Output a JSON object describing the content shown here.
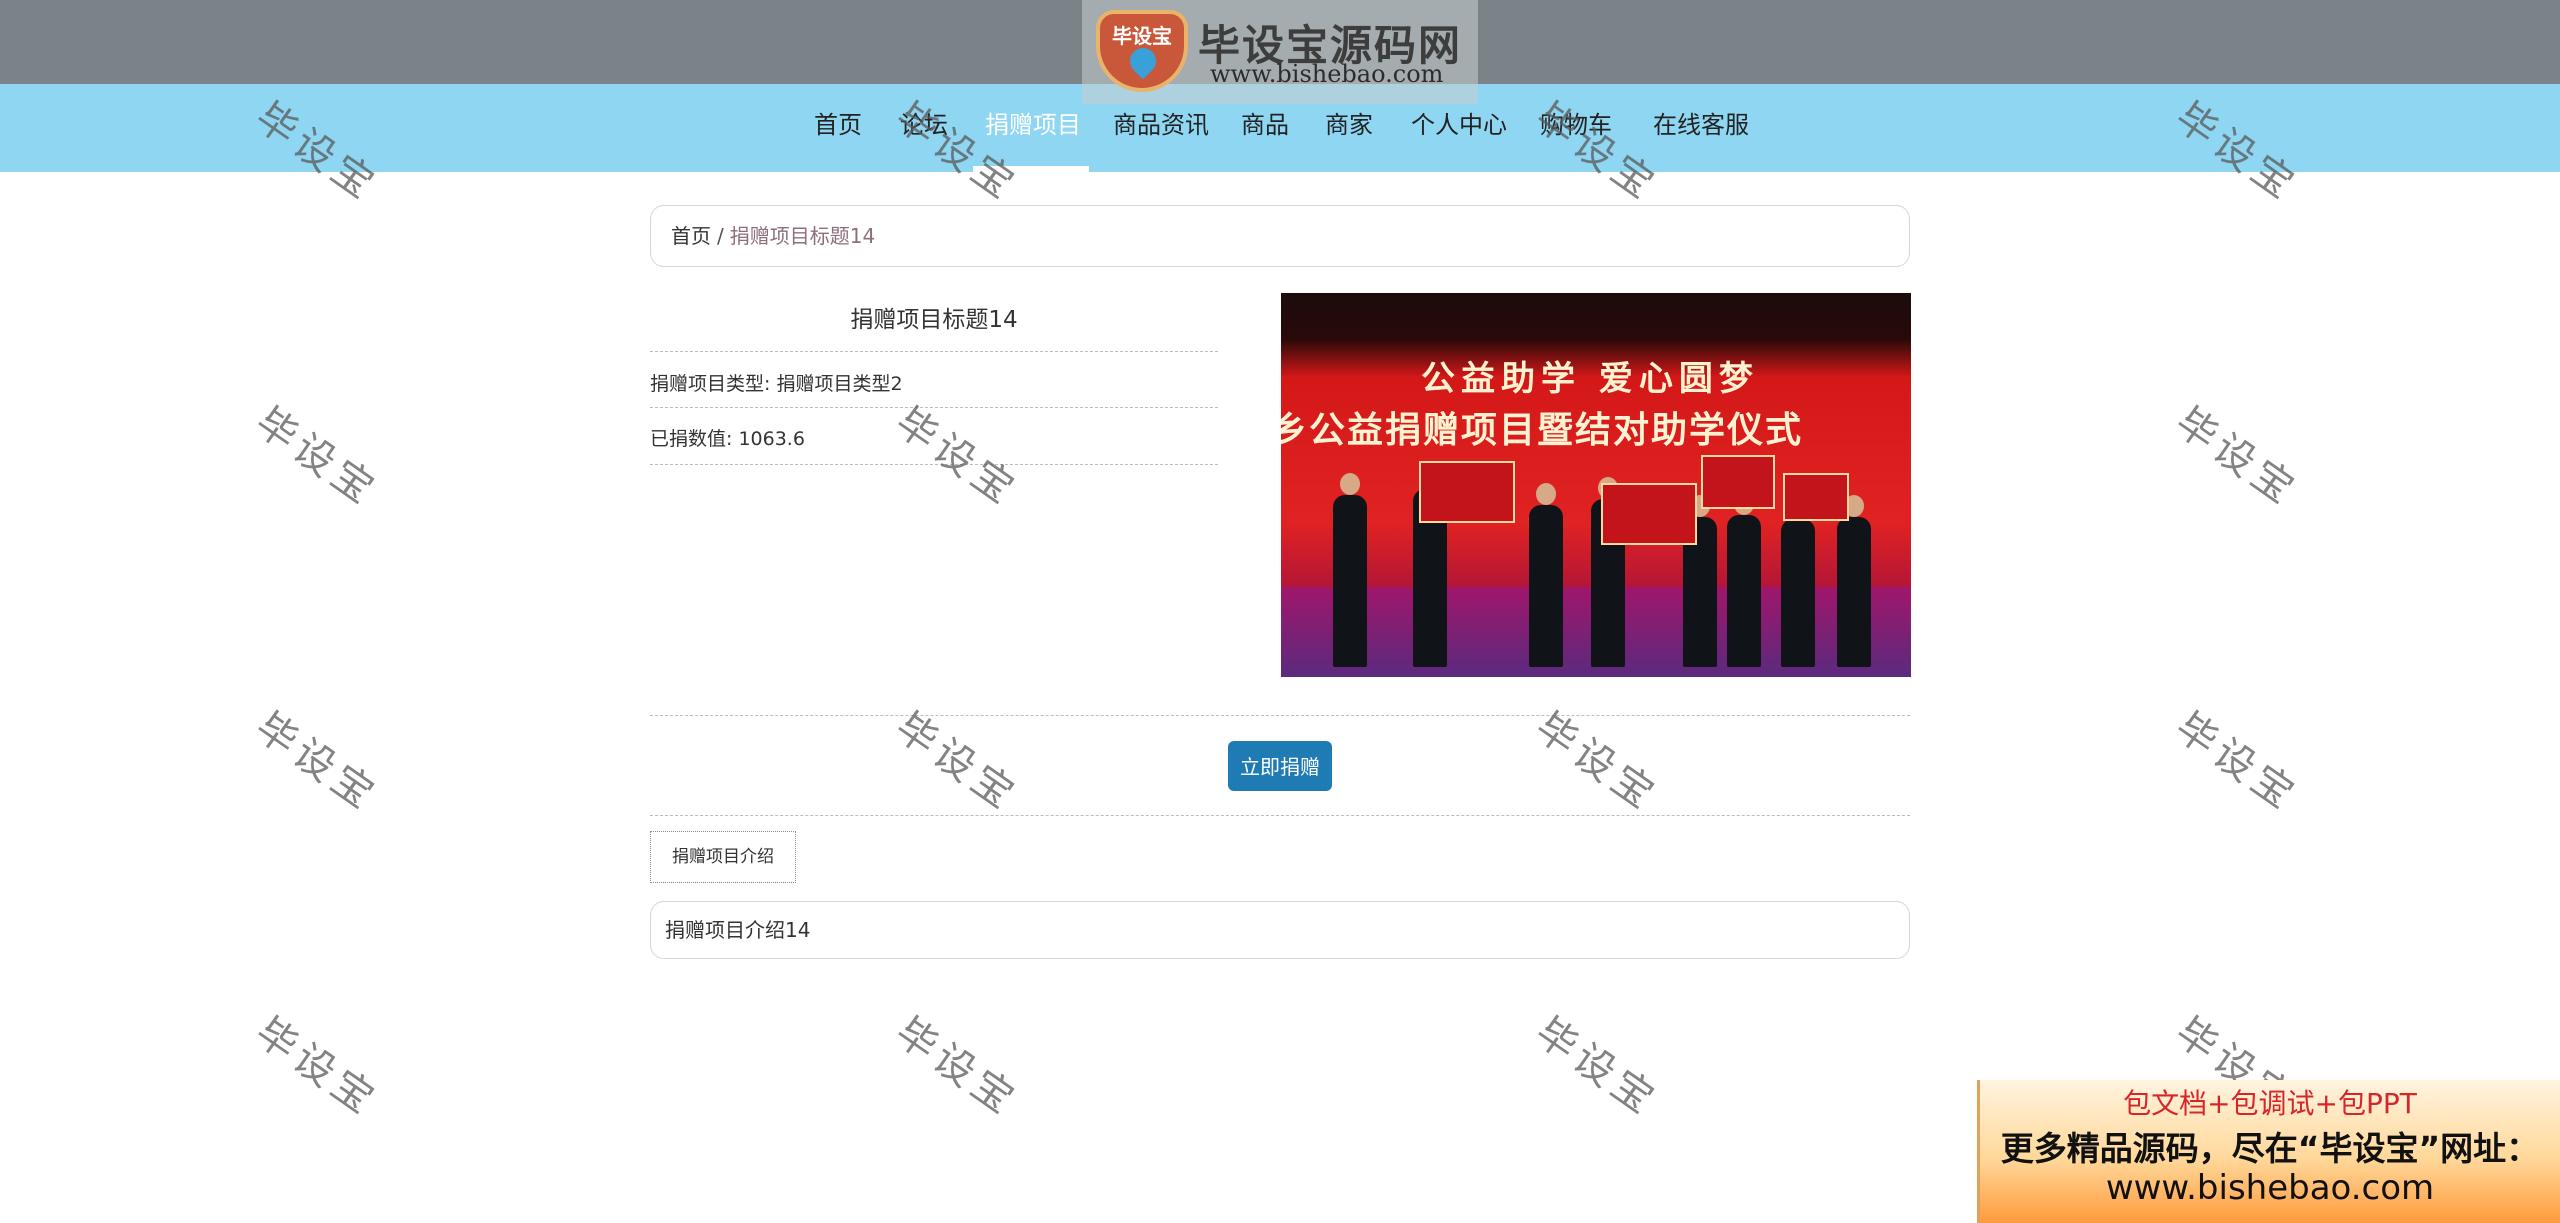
{
  "logo": {
    "badge": "毕设宝",
    "title": "毕设宝源码网",
    "url": "www.bishebao.com"
  },
  "nav": {
    "items": [
      {
        "label": "首页",
        "active": false
      },
      {
        "label": "论坛",
        "active": false
      },
      {
        "label": "捐赠项目",
        "active": true
      },
      {
        "label": "商品资讯",
        "active": false
      },
      {
        "label": "商品",
        "active": false
      },
      {
        "label": "商家",
        "active": false
      },
      {
        "label": "个人中心",
        "active": false
      },
      {
        "label": "购物车",
        "active": false
      },
      {
        "label": "在线客服",
        "active": false
      }
    ]
  },
  "breadcrumb": {
    "home": "首页",
    "separator": "/",
    "current": "捐赠项目标题14"
  },
  "detail": {
    "title": "捐赠项目标题14",
    "type_label": "捐赠项目类型: 捐赠项目类型2",
    "amount_label": "已捐数值: 1063.6"
  },
  "photo": {
    "banner_line1": "公益助学 爱心圆梦",
    "banner_line2": "乡公益捐赠项目暨结对助学仪式"
  },
  "actions": {
    "donate_label": "立即捐赠"
  },
  "tabs": {
    "intro_label": "捐赠项目介绍"
  },
  "intro": {
    "content": "捐赠项目介绍14"
  },
  "watermark": {
    "text": "毕设宝"
  },
  "ad": {
    "line1": "包文档+包调试+包PPT",
    "line2": "更多精品源码，尽在“毕设宝”网址：",
    "line3": "www.bishebao.com"
  },
  "colors": {
    "topbar": "#7b8388",
    "navbar": "#8fd6f2",
    "button": "#1e7bb4",
    "breadcrumb_current": "#8c6f7d"
  }
}
